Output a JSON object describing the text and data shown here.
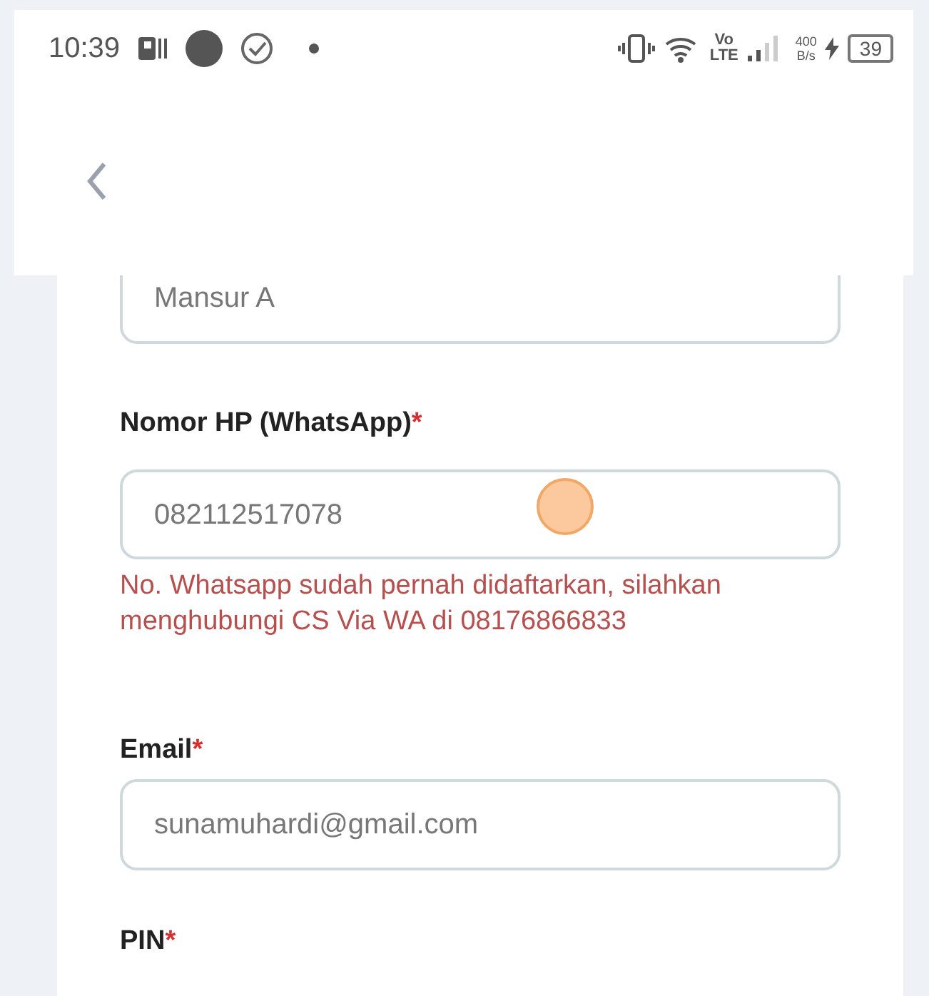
{
  "status_bar": {
    "time": "10:39",
    "network_top": "Vo",
    "network_bottom": "LTE",
    "speed_value": "400",
    "speed_unit": "B/s",
    "battery": "39"
  },
  "form": {
    "required_mark": "*",
    "fields": [
      {
        "value": "Mansur A"
      },
      {
        "label": "Nomor HP (WhatsApp)",
        "required": true,
        "value": "082112517078",
        "error": "No. Whatsapp sudah pernah didaftarkan, silahkan menghubungi CS Via WA di 08176866833"
      },
      {
        "label": "Email",
        "required": true,
        "value": "sunamuhardi@gmail.com"
      },
      {
        "label": "PIN",
        "required": true
      }
    ]
  }
}
